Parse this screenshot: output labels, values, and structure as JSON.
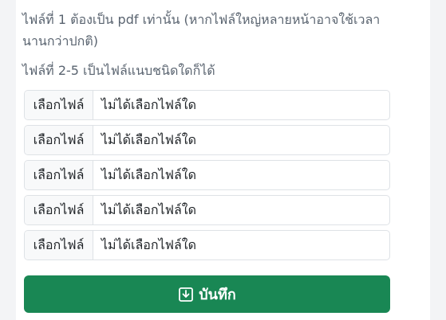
{
  "notes": {
    "line1": "ไฟล์ที่ 1 ต้องเป็น pdf เท่านั้น (หากไฟล์ใหญ่หลายหน้าอาจใช้เวลา",
    "line1b": "นานกว่าปกติ)",
    "line2": "ไฟล์ที่ 2-5 เป็นไฟล์แนบชนิดใดก็ได้"
  },
  "files": [
    {
      "button": "เลือกไฟล์",
      "status": "ไม่ได้เลือกไฟล์ใด"
    },
    {
      "button": "เลือกไฟล์",
      "status": "ไม่ได้เลือกไฟล์ใด"
    },
    {
      "button": "เลือกไฟล์",
      "status": "ไม่ได้เลือกไฟล์ใด"
    },
    {
      "button": "เลือกไฟล์",
      "status": "ไม่ได้เลือกไฟล์ใด"
    },
    {
      "button": "เลือกไฟล์",
      "status": "ไม่ได้เลือกไฟล์ใด"
    }
  ],
  "save": {
    "label": "บันทึก",
    "icon": "save-download-icon",
    "color": "#198754"
  }
}
